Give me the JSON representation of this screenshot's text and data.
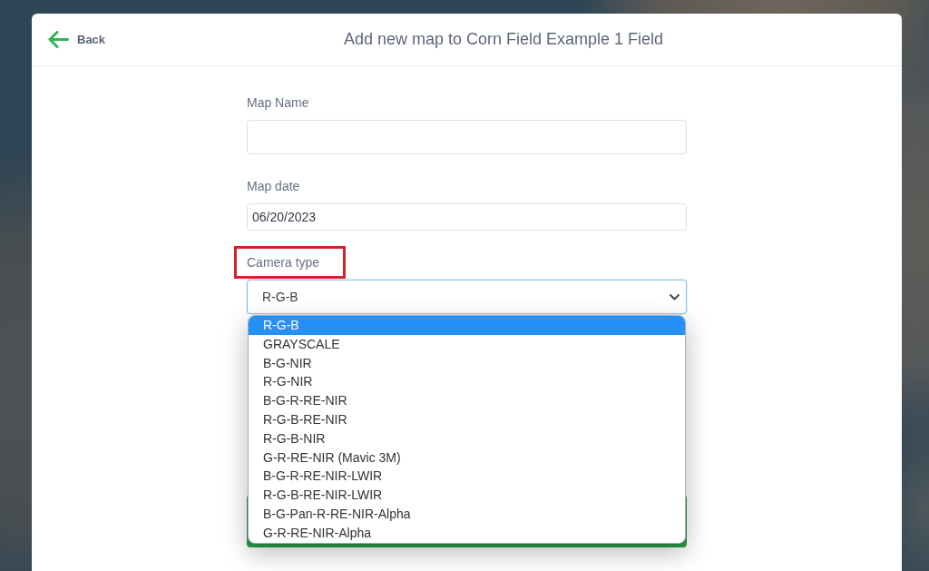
{
  "header": {
    "back": {
      "label": "Back"
    },
    "title": "Add new map to Corn Field Example 1 Field"
  },
  "form": {
    "fields": [
      {
        "kind": "text",
        "label": "Map Name"
      },
      {
        "kind": "date",
        "label": "Map date",
        "value": "06/20/2023"
      },
      {
        "kind": "select",
        "label": "Camera type",
        "highlighted": true,
        "focused": true,
        "expanded": true,
        "value": "R-G-B",
        "options": [
          {
            "label": "R-G-B",
            "selected": true
          },
          {
            "label": "GRAYSCALE",
            "selected": false
          },
          {
            "label": "B-G-NIR",
            "selected": false
          },
          {
            "label": "R-G-NIR",
            "selected": false
          },
          {
            "label": "B-G-R-RE-NIR",
            "selected": false
          },
          {
            "label": "R-G-B-RE-NIR",
            "selected": false
          },
          {
            "label": "R-G-B-NIR",
            "selected": false
          },
          {
            "label": "G-R-RE-NIR (Mavic 3M)",
            "selected": false
          },
          {
            "label": "B-G-R-RE-NIR-LWIR",
            "selected": false
          },
          {
            "label": "R-G-B-RE-NIR-LWIR",
            "selected": false
          },
          {
            "label": "B-G-Pan-R-RE-NIR-Alpha",
            "selected": false
          },
          {
            "label": "G-R-RE-NIR-Alpha",
            "selected": false
          }
        ]
      }
    ]
  }
}
